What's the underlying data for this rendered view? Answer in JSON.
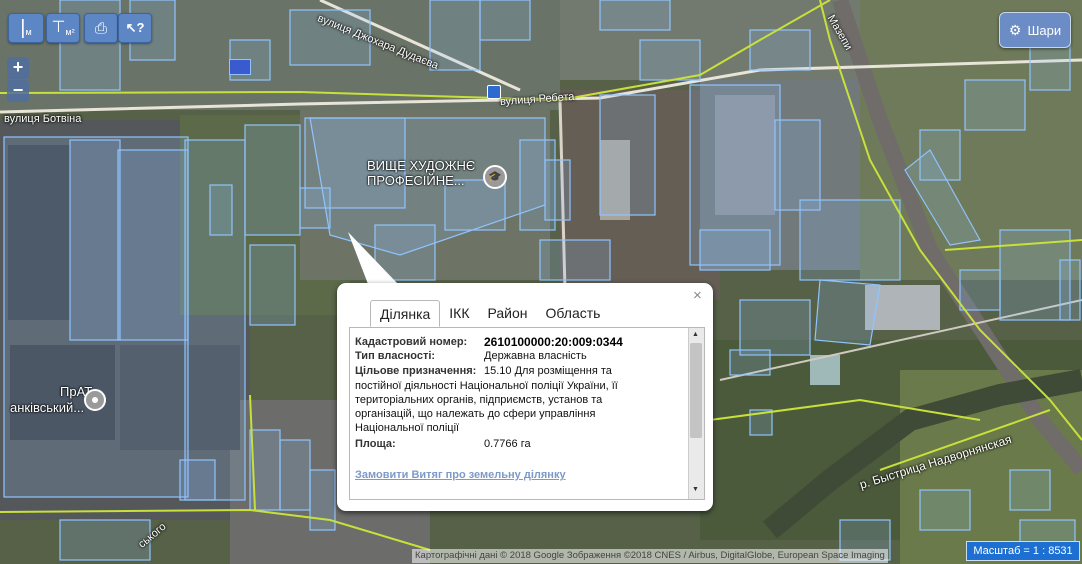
{
  "toolbar": {
    "measure_length_label": "м",
    "measure_area_label": "м²",
    "print_icon": "printer-icon",
    "info_icon": "cursor-question-icon"
  },
  "zoom": {
    "in_label": "+",
    "out_label": "−"
  },
  "layers_button": {
    "label": "Шари",
    "icon": "gear-icon"
  },
  "map_labels": {
    "street_1": "вулиця Джохара Дудаєва",
    "street_2": "вулиця Ребета",
    "street_3": "вулиця Ботвіна",
    "street_4": "Мазепи",
    "street_5": "ського",
    "river": "р. Быстрица Надворнянская",
    "poi_1_line1": "ВИЩЕ ХУДОЖНЄ",
    "poi_1_line2": "ПРОФЕСІЙНЕ...",
    "poi_2_line1": "ПрАТ",
    "poi_2_line2": "анківський..."
  },
  "popup": {
    "tabs": [
      "Ділянка",
      "ІКК",
      "Район",
      "Область"
    ],
    "active_tab": "Ділянка",
    "cadastral_key": "Кадастровий номер:",
    "cadastral_value": "2610100000:20:009:0344",
    "ownership_key": "Тип власності:",
    "ownership_value": "Державна власність",
    "purpose_key": "Цільове призначення:",
    "purpose_line1": "15.10 Для розміщення та",
    "purpose_line2": "постійної діяльності Національної поліції України, її",
    "purpose_line3": "територіальних органів, підприємств, установ та",
    "purpose_line4": "організацій, що належать до сфери управління",
    "purpose_line5": "Національної поліції",
    "area_key": "Площа:",
    "area_value": "0.7766 га",
    "order_link": "Замовити Витяг про земельну ділянку",
    "close_label": "×"
  },
  "scale": {
    "label": "Масштаб = 1 : 8531"
  },
  "attribution": "Картографічні дані © 2018 Google Зображення ©2018 CNES / Airbus, DigitalGlobe, European Space Imaging",
  "colors": {
    "parcel_stroke": "#8fc4ff",
    "boundary": "#c8e03a",
    "accent": "#5d86c4"
  }
}
